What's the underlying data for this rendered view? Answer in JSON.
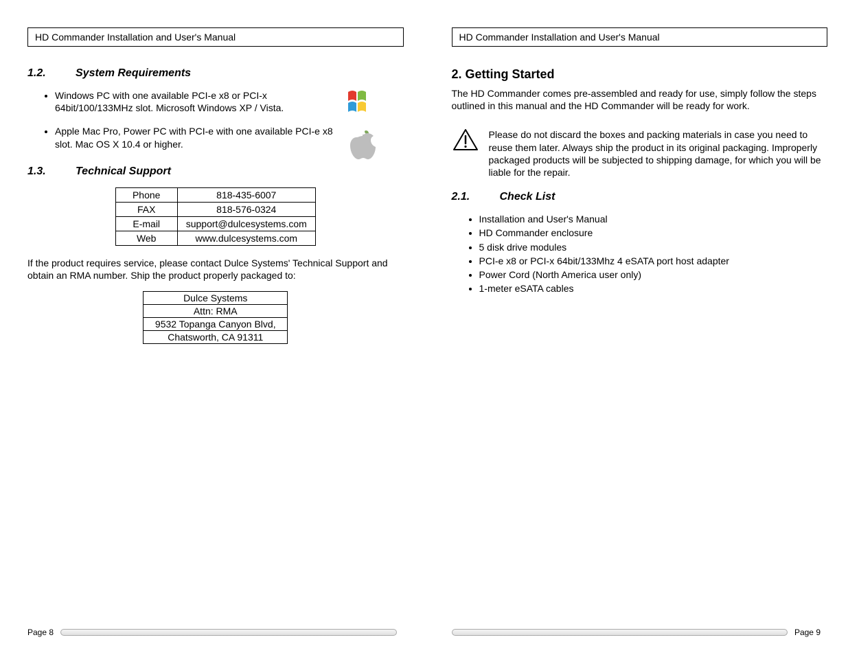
{
  "header_title": "HD Commander Installation and User's Manual",
  "left": {
    "s12_num": "1.2.",
    "s12_title": "System Requirements",
    "req_items": [
      "Windows PC with one available PCI-e x8 or PCI-x 64bit/100/133MHz slot.  Microsoft Windows XP / Vista.",
      "Apple Mac Pro, Power PC with PCI-e with one available PCI-e x8 slot.  Mac OS X 10.4 or higher."
    ],
    "s13_num": "1.3.",
    "s13_title": "Technical Support",
    "support_rows": [
      {
        "label": "Phone",
        "value": "818-435-6007"
      },
      {
        "label": "FAX",
        "value": "818-576-0324"
      },
      {
        "label": "E-mail",
        "value": "support@dulcesystems.com"
      },
      {
        "label": "Web",
        "value": "www.dulcesystems.com"
      }
    ],
    "rma_para": "If the product requires service, please contact Dulce Systems' Technical Support and obtain an RMA number.  Ship the product properly packaged to:",
    "address_rows": [
      "Dulce Systems",
      "Attn: RMA",
      "9532 Topanga Canyon Blvd,",
      "Chatsworth, CA  91311"
    ],
    "page_label": "Page 8"
  },
  "right": {
    "h2": "2. Getting Started",
    "intro": "The HD Commander comes pre-assembled and ready for use, simply follow the steps outlined in this manual and the HD Commander will be ready for work.",
    "warning": "Please do not discard the boxes and packing materials in case you need to reuse them later.  Always ship the product in its original packaging.  Improperly packaged products will be subjected to shipping damage, for which you will be liable for the repair.",
    "s21_num": "2.1.",
    "s21_title": "Check List",
    "checklist": [
      "Installation and User's Manual",
      "HD Commander enclosure",
      "5 disk drive modules",
      "PCI-e x8 or PCI-x 64bit/133Mhz 4 eSATA port host adapter",
      "Power Cord (North America user only)",
      "1-meter eSATA cables"
    ],
    "page_label": "Page 9"
  },
  "icons": {
    "windows": "windows-logo-icon",
    "apple": "apple-logo-icon",
    "warning": "warning-triangle-icon"
  }
}
